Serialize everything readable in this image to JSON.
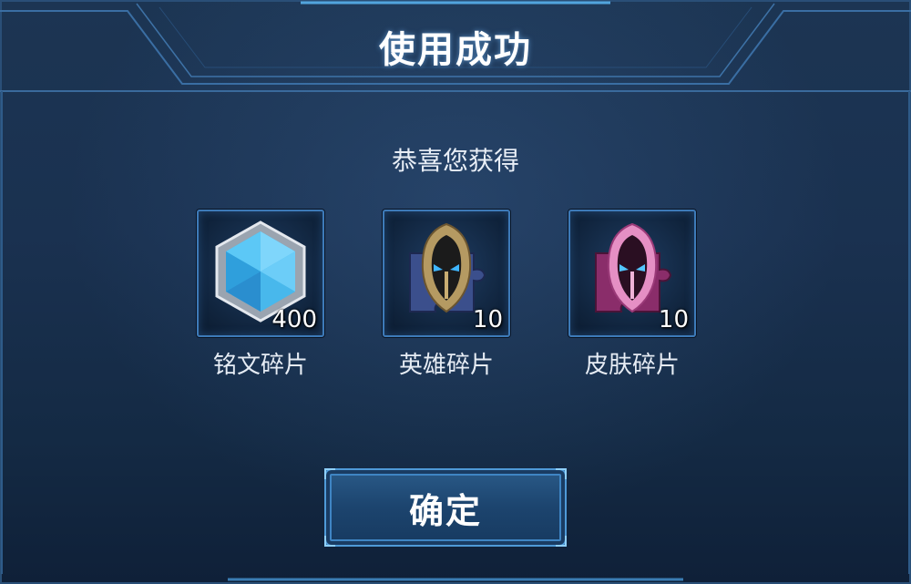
{
  "dialog": {
    "title": "使用成功",
    "subtitle": "恭喜您获得"
  },
  "rewards": [
    {
      "name": "铭文碎片",
      "count": "400",
      "icon": "inscription-shard-icon"
    },
    {
      "name": "英雄碎片",
      "count": "10",
      "icon": "hero-shard-icon"
    },
    {
      "name": "皮肤碎片",
      "count": "10",
      "icon": "skin-shard-icon"
    }
  ],
  "buttons": {
    "confirm_label": "确定"
  },
  "colors": {
    "accent": "#3d7ab8",
    "panel": "#1a3150",
    "glow": "#5fb0ff"
  }
}
